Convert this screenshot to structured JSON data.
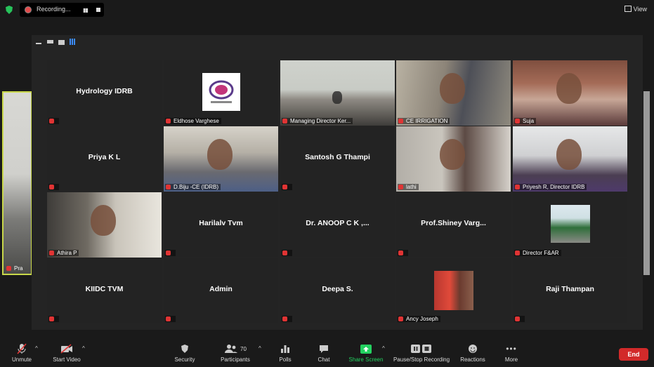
{
  "recording": {
    "label": "Recording..."
  },
  "view_label": "View",
  "side_participant": {
    "label": "Pra"
  },
  "participants": [
    {
      "name": "Hydrology IDRB",
      "display": "name",
      "tag": ""
    },
    {
      "name": "Eldhose Varghese",
      "display": "logo",
      "tag": "Eldhose Varghese"
    },
    {
      "name": "Managing Director Ker...",
      "display": "video",
      "tag": "Managing Director Ker..."
    },
    {
      "name": "CE IRRIGATION",
      "display": "video",
      "tag": "CE IRRIGATION"
    },
    {
      "name": "Suja",
      "display": "video",
      "tag": "Suja"
    },
    {
      "name": "Priya K L",
      "display": "name",
      "tag": ""
    },
    {
      "name": "D.Biju -CE (IDRB)",
      "display": "video",
      "tag": "D.Biju -CE (IDRB)"
    },
    {
      "name": "Santosh G Thampi",
      "display": "name",
      "tag": ""
    },
    {
      "name": "lathi",
      "display": "video",
      "tag": "lathi"
    },
    {
      "name": "Priyesh R, Director IDRB",
      "display": "video",
      "tag": "Priyesh R, Director IDRB"
    },
    {
      "name": "Athira P",
      "display": "video",
      "tag": "Athira P"
    },
    {
      "name": "Harilalv Tvm",
      "display": "name",
      "tag": ""
    },
    {
      "name": "Dr. ANOOP C K ,...",
      "display": "name",
      "tag": ""
    },
    {
      "name": "Prof.Shiney  Varg...",
      "display": "name",
      "tag": ""
    },
    {
      "name": "Director F&AR",
      "display": "photo",
      "tag": "Director F&AR"
    },
    {
      "name": "KIIDC TVM",
      "display": "name",
      "tag": ""
    },
    {
      "name": "Admin",
      "display": "name",
      "tag": ""
    },
    {
      "name": "Deepa S.",
      "display": "name",
      "tag": ""
    },
    {
      "name": "Ancy Joseph",
      "display": "photo",
      "tag": "Ancy Joseph"
    },
    {
      "name": "Raji Thampan",
      "display": "name",
      "tag": ""
    }
  ],
  "toolbar": {
    "unmute": "Unmute",
    "start_video": "Start Video",
    "security": "Security",
    "participants": "Participants",
    "participants_count": "70",
    "polls": "Polls",
    "chat": "Chat",
    "share_screen": "Share Screen",
    "pause_stop": "Pause/Stop Recording",
    "reactions": "Reactions",
    "more": "More",
    "end": "End"
  },
  "colors": {
    "accent_green": "#23d160",
    "end_red": "#d22a2a",
    "mic_red": "#e03434"
  }
}
